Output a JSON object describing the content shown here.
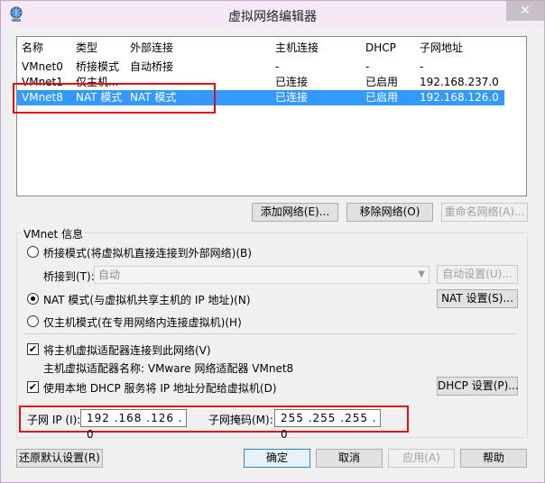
{
  "window": {
    "title": "虚拟网络编辑器",
    "close_label": "✕"
  },
  "list": {
    "columns": [
      "名称",
      "类型",
      "外部连接",
      "主机连接",
      "DHCP",
      "子网地址"
    ],
    "rows": [
      {
        "name": "VMnet0",
        "type": "桥接模式",
        "external": "自动桥接",
        "host": "-",
        "dhcp": "-",
        "subnet": "-"
      },
      {
        "name": "VMnet1",
        "type": "仅主机...",
        "external": "",
        "host": "已连接",
        "dhcp": "已启用",
        "subnet": "192.168.237.0"
      },
      {
        "name": "VMnet8",
        "type": "NAT 模式",
        "external": "NAT 模式",
        "host": "已连接",
        "dhcp": "已启用",
        "subnet": "192.168.126.0",
        "selected": true
      }
    ]
  },
  "list_buttons": {
    "add": "添加网络(E)...",
    "remove": "移除网络(O)",
    "rename": "重命名网络(A)..."
  },
  "vmnet_info": {
    "group_label": "VMnet 信息",
    "bridge_radio": "桥接模式(将虚拟机直接连接到外部网络)(B)",
    "bridge_to_label": "桥接到(T):",
    "bridge_to_value": "自动",
    "auto_settings": "自动设置(U)...",
    "nat_radio": "NAT 模式(与虚拟机共享主机的 IP 地址)(N)",
    "nat_settings": "NAT 设置(S)...",
    "hostonly_radio": "仅主机模式(在专用网络内连接虚拟机)(H)",
    "connect_adapter_check": "将主机虚拟适配器连接到此网络(V)",
    "adapter_name": "主机虚拟适配器名称: VMware 网络适配器 VMnet8",
    "dhcp_check": "使用本地 DHCP 服务将 IP 地址分配给虚拟机(D)",
    "dhcp_settings": "DHCP 设置(P)...",
    "subnet_ip_label": "子网 IP (I):",
    "subnet_ip_value": "192 .168 .126 . 0",
    "subnet_mask_label": "子网掩码(M):",
    "subnet_mask_value": "255 .255 .255 . 0"
  },
  "footer": {
    "restore": "还原默认设置(R)",
    "ok": "确定",
    "cancel": "取消",
    "apply": "应用(A)",
    "help": "帮助"
  },
  "colors": {
    "selection": "#3399ff",
    "highlight_box": "#e0101a"
  }
}
